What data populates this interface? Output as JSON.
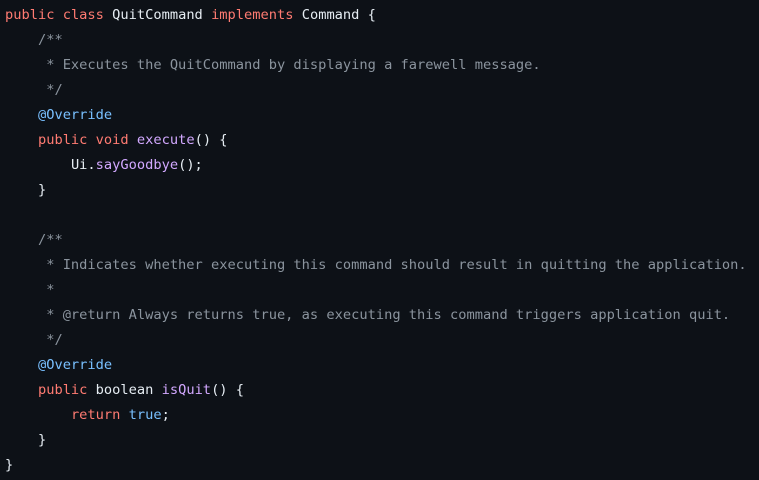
{
  "code": {
    "class_decl": {
      "kw_public": "public",
      "kw_class": "class",
      "class_name": "QuitCommand",
      "kw_implements": "implements",
      "iface_name": "Command",
      "brace_open": " {"
    },
    "doc1": {
      "open": "/**",
      "body": " * Executes the QuitCommand by displaying a farewell message.",
      "close": " */"
    },
    "override1": "@Override",
    "method1": {
      "kw_public": "public",
      "kw_void": "void",
      "name": "execute",
      "sig_rest": "() {"
    },
    "method1_body": {
      "receiver": "Ui",
      "dot": ".",
      "call": "sayGoodbye",
      "rest": "();"
    },
    "method1_close": "}",
    "doc2": {
      "open": "/**",
      "body": " * Indicates whether executing this command should result in quitting the application.",
      "blank": " *",
      "return_tag": " * @return Always returns true, as executing this command triggers application quit.",
      "close": " */"
    },
    "override2": "@Override",
    "method2": {
      "kw_public": "public",
      "kw_boolean": "boolean",
      "name": "isQuit",
      "sig_rest": "() {"
    },
    "method2_body": {
      "kw_return": "return",
      "value": "true",
      "semi": ";"
    },
    "method2_close": "}",
    "class_close": "}"
  },
  "colors": {
    "background": "#0d1117",
    "keyword": "#ff7b72",
    "function": "#d2a8ff",
    "comment": "#8b949e",
    "annotation": "#79c0ff",
    "plain": "#e6edf3"
  }
}
